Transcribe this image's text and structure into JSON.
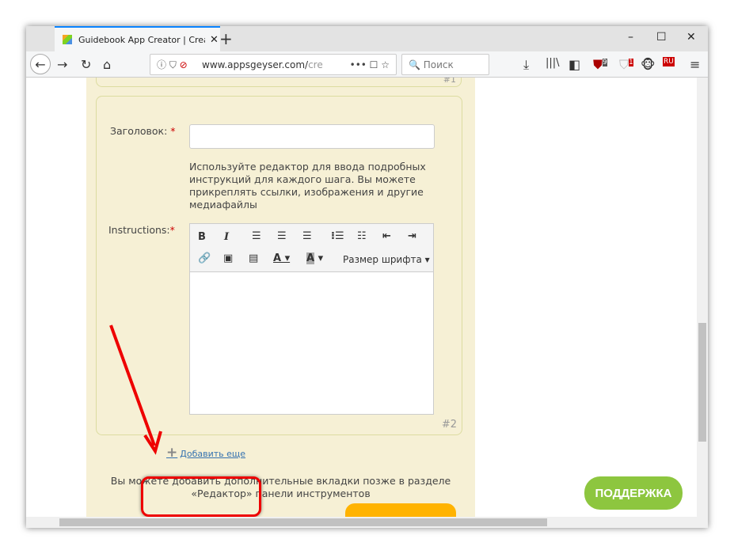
{
  "browser": {
    "tab_title": "Guidebook App Creator | Creat",
    "url_main": "www.appsgeyser.com/",
    "url_rest": "cre",
    "search_placeholder": "Поиск",
    "badge_9": "9",
    "badge_1": "1",
    "badge_ru": "RU"
  },
  "form": {
    "title_label": "Заголовок:",
    "required_mark": "*",
    "help_text": "Используйте редактор для ввода подробных инструкций для каждого шага. Вы можете прикреплять ссылки, изображения и другие медиафайлы",
    "instructions_label": "Instructions:",
    "font_size_label": "Размер шрифта",
    "step_number": "#2",
    "prev_step_number": "#1",
    "add_more": "Добавить еще",
    "note": "Вы можете добавить дополнительные вкладки позже в разделе «Редактор» панели инструментов"
  },
  "support_label": "ПОДДЕРЖКА",
  "colors": {
    "panel": "#f6f0d5",
    "support": "#8dc63f",
    "highlight": "#e00000",
    "orange": "#ffb300"
  }
}
